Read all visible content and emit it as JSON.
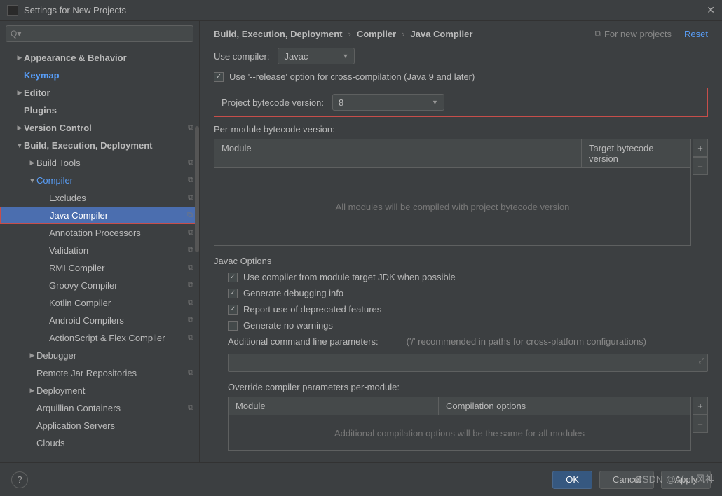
{
  "title": "Settings for New Projects",
  "search_placeholder": "",
  "tree": [
    {
      "label": "Appearance & Behavior",
      "depth": 0,
      "arrow": "▶",
      "bold": true
    },
    {
      "label": "Keymap",
      "depth": 0,
      "link": true,
      "bold": true
    },
    {
      "label": "Editor",
      "depth": 0,
      "arrow": "▶",
      "bold": true
    },
    {
      "label": "Plugins",
      "depth": 0,
      "bold": true
    },
    {
      "label": "Version Control",
      "depth": 0,
      "arrow": "▶",
      "bold": true,
      "copy": true
    },
    {
      "label": "Build, Execution, Deployment",
      "depth": 0,
      "arrow": "▼",
      "bold": true
    },
    {
      "label": "Build Tools",
      "depth": 1,
      "arrow": "▶",
      "copy": true
    },
    {
      "label": "Compiler",
      "depth": 1,
      "arrow": "▼",
      "link": true,
      "copy": true
    },
    {
      "label": "Excludes",
      "depth": 2,
      "copy": true
    },
    {
      "label": "Java Compiler",
      "depth": 2,
      "copy": true,
      "selected": true,
      "highlight": true
    },
    {
      "label": "Annotation Processors",
      "depth": 2,
      "copy": true
    },
    {
      "label": "Validation",
      "depth": 2,
      "copy": true
    },
    {
      "label": "RMI Compiler",
      "depth": 2,
      "copy": true
    },
    {
      "label": "Groovy Compiler",
      "depth": 2,
      "copy": true
    },
    {
      "label": "Kotlin Compiler",
      "depth": 2,
      "copy": true
    },
    {
      "label": "Android Compilers",
      "depth": 2,
      "copy": true
    },
    {
      "label": "ActionScript & Flex Compiler",
      "depth": 2,
      "copy": true
    },
    {
      "label": "Debugger",
      "depth": 1,
      "arrow": "▶"
    },
    {
      "label": "Remote Jar Repositories",
      "depth": 1,
      "copy": true
    },
    {
      "label": "Deployment",
      "depth": 1,
      "arrow": "▶"
    },
    {
      "label": "Arquillian Containers",
      "depth": 1,
      "copy": true
    },
    {
      "label": "Application Servers",
      "depth": 1
    },
    {
      "label": "Clouds",
      "depth": 1
    }
  ],
  "breadcrumb": [
    "Build, Execution, Deployment",
    "Compiler",
    "Java Compiler"
  ],
  "for_new_label": "For new projects",
  "reset_label": "Reset",
  "use_compiler_label": "Use compiler:",
  "use_compiler_value": "Javac",
  "release_option_label": "Use '--release' option for cross-compilation (Java 9 and later)",
  "project_bytecode_label": "Project bytecode version:",
  "project_bytecode_value": "8",
  "per_module_label": "Per-module bytecode version:",
  "table1": {
    "col1": "Module",
    "col2": "Target bytecode version",
    "empty": "All modules will be compiled with project bytecode version"
  },
  "javac_options_title": "Javac Options",
  "opt1": "Use compiler from module target JDK when possible",
  "opt2": "Generate debugging info",
  "opt3": "Report use of deprecated features",
  "opt4": "Generate no warnings",
  "additional_params_label": "Additional command line parameters:",
  "additional_params_hint": "('/' recommended in paths for cross-platform configurations)",
  "override_label": "Override compiler parameters per-module:",
  "table2": {
    "col1": "Module",
    "col2": "Compilation options",
    "empty": "Additional compilation options will be the same for all modules"
  },
  "footer": {
    "ok": "OK",
    "cancel": "Cancel",
    "apply": "Apply"
  },
  "watermark": "CSDN @メ、风神"
}
